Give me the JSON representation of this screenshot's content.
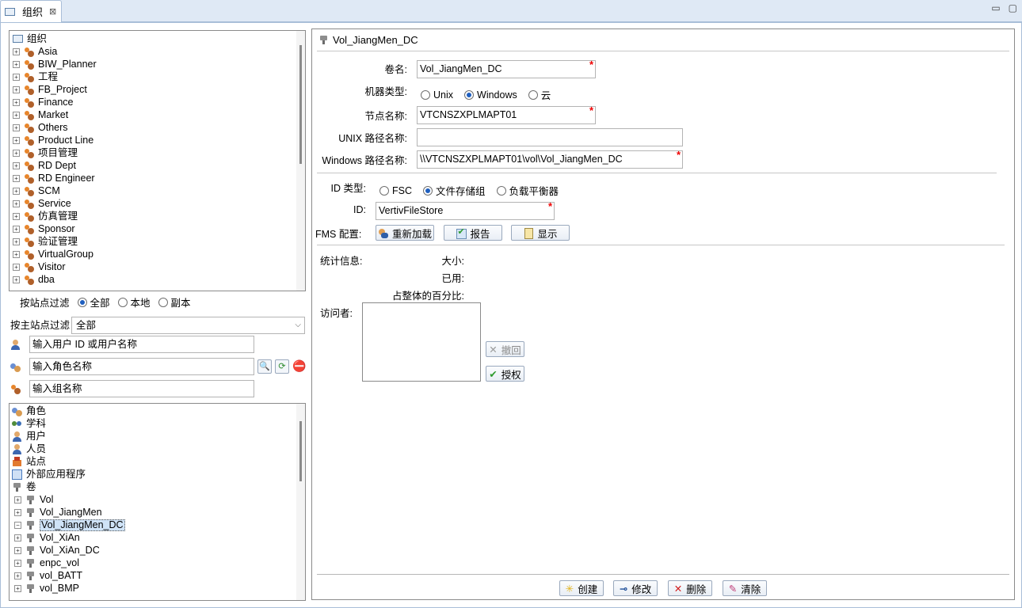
{
  "tab": {
    "title": "组织",
    "close_glyph": "⊠"
  },
  "window_buttons": {
    "minimize": "▭",
    "maximize": "▢"
  },
  "org_tree": {
    "root": "组织",
    "items": [
      "Asia",
      "BIW_Planner",
      "工程",
      "FB_Project",
      "Finance",
      "Market",
      "Others",
      "Product Line",
      "项目管理",
      "RD Dept",
      "RD Engineer",
      "SCM",
      "Service",
      "仿真管理",
      "Sponsor",
      "验证管理",
      "VirtualGroup",
      "Visitor",
      "dba"
    ]
  },
  "site_filter": {
    "label": "按站点过滤",
    "options": [
      {
        "label": "全部",
        "selected": true
      },
      {
        "label": "本地",
        "selected": false
      },
      {
        "label": "副本",
        "selected": false
      }
    ]
  },
  "primary_site_filter": {
    "label": "按主站点过滤",
    "value": "全部"
  },
  "search": {
    "user_placeholder": "输入用户 ID 或用户名称",
    "role_placeholder": "输入角色名称",
    "group_placeholder": "输入组名称"
  },
  "type_tree": {
    "items": [
      {
        "label": "角色",
        "icon": "role-icon"
      },
      {
        "label": "学科",
        "icon": "discipline-icon"
      },
      {
        "label": "用户",
        "icon": "user-icon"
      },
      {
        "label": "人员",
        "icon": "person-icon"
      },
      {
        "label": "站点",
        "icon": "site-icon"
      },
      {
        "label": "外部应用程序",
        "icon": "app-icon"
      },
      {
        "label": "卷",
        "icon": "volume-icon"
      }
    ],
    "volumes": [
      "Vol",
      "Vol_JiangMen",
      "Vol_JiangMen_DC",
      "Vol_XiAn",
      "Vol_XiAn_DC",
      "enpc_vol",
      "vol_BATT",
      "vol_BMP"
    ],
    "selected_volume": "Vol_JiangMen_DC"
  },
  "detail": {
    "title": "Vol_JiangMen_DC",
    "volume_name": {
      "label": "卷名:",
      "value": "Vol_JiangMen_DC"
    },
    "machine_type": {
      "label": "机器类型:",
      "options": [
        {
          "label": "Unix",
          "selected": false
        },
        {
          "label": "Windows",
          "selected": true
        },
        {
          "label": "云",
          "selected": false
        }
      ]
    },
    "node_name": {
      "label": "节点名称:",
      "value": "VTCNSZXPLMAPT01"
    },
    "unix_path": {
      "label": "UNIX 路径名称:",
      "value": ""
    },
    "windows_path": {
      "label": "Windows 路径名称:",
      "value": "\\\\VTCNSZXPLMAPT01\\vol\\Vol_JiangMen_DC"
    },
    "id_type": {
      "label": "ID 类型:",
      "options": [
        {
          "label": "FSC",
          "selected": false
        },
        {
          "label": "文件存储组",
          "selected": true
        },
        {
          "label": "负载平衡器",
          "selected": false
        }
      ]
    },
    "id": {
      "label": "ID:",
      "value": "VertivFileStore"
    },
    "fms": {
      "label": "FMS 配置:",
      "reload": "重新加载",
      "report": "报告",
      "show": "显示"
    },
    "stats": {
      "label": "统计信息:",
      "size": "大小:",
      "used": "已用:",
      "percent": "占整体的百分比:"
    },
    "visitors": {
      "label": "访问者:",
      "revoke": "撤回",
      "grant": "授权"
    },
    "required_mark": "*"
  },
  "actions": {
    "create": "创建",
    "modify": "修改",
    "delete": "删除",
    "clear": "清除"
  }
}
